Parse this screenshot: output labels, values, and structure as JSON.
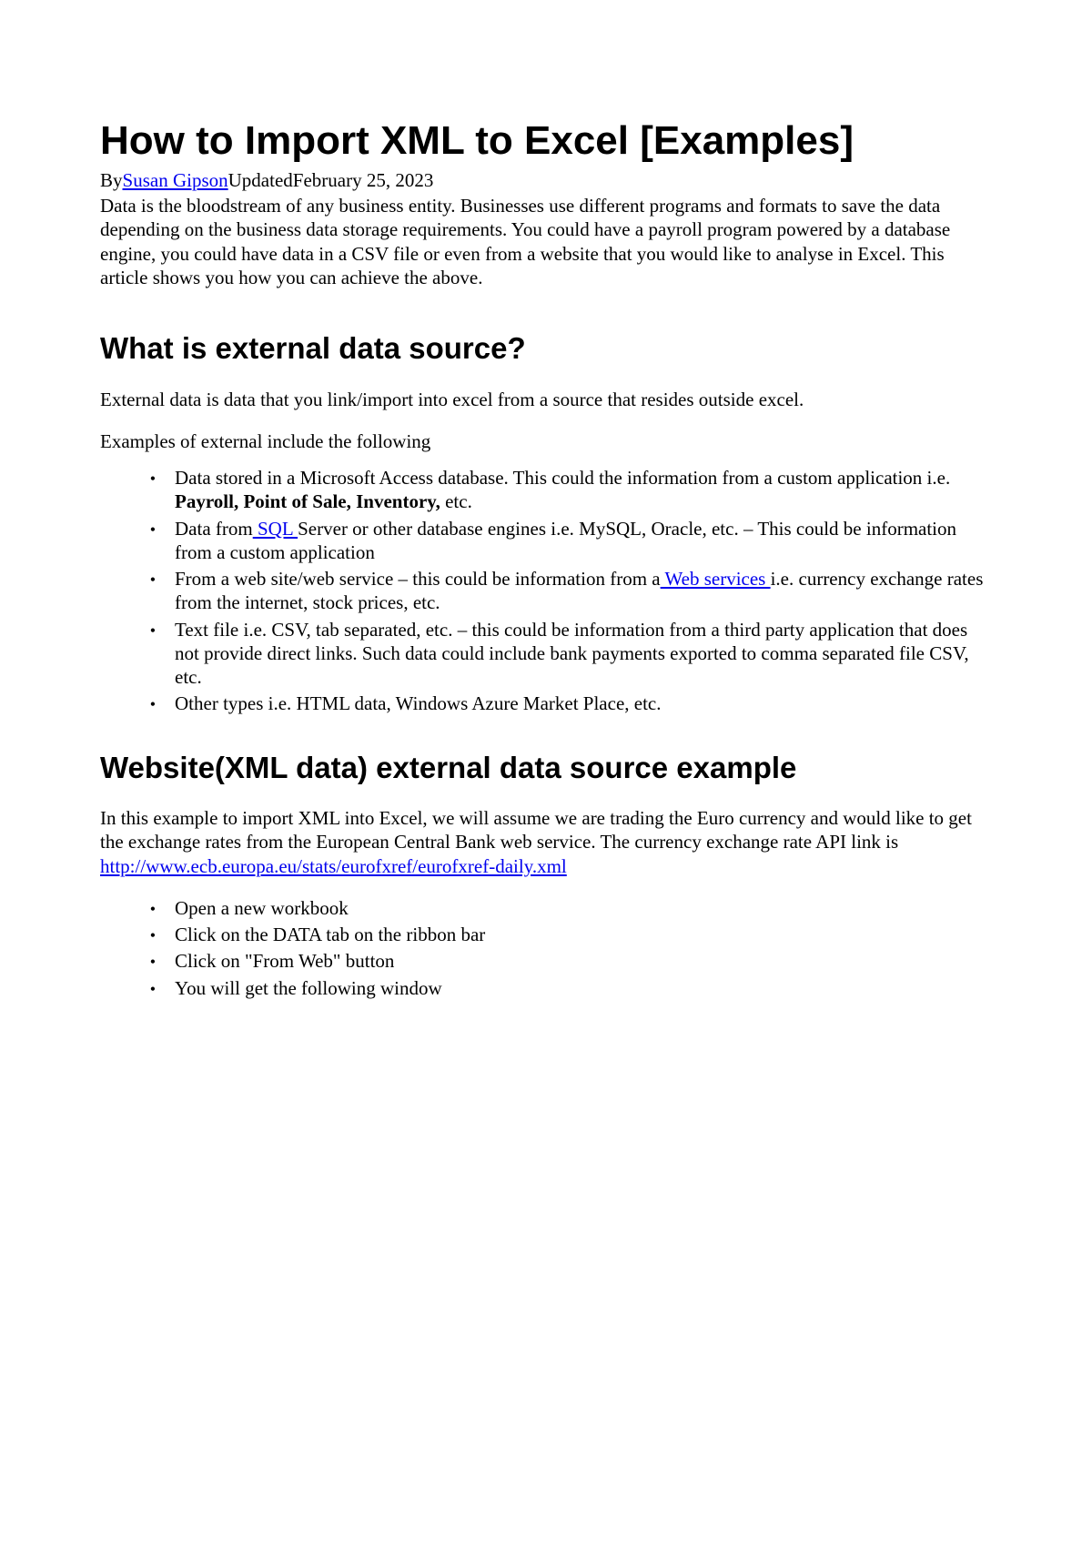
{
  "title": "How to Import XML to Excel [Examples]",
  "byline": {
    "by": "By",
    "author": "Susan Gipson",
    "updated": "Updated",
    "date": "February 25, 2023"
  },
  "intro": "Data is the bloodstream of any business entity. Businesses use different programs and formats to save the data depending on the business data storage requirements. You could have a payroll program powered by a database engine, you could have data in a CSV file or even from a website that you would like to analyse in Excel. This article shows you how you can achieve the above.",
  "section1": {
    "heading": "What is external data source?",
    "p1": "External data is data that you link/import into excel from a source that resides outside excel.",
    "p2": "Examples of external include the following",
    "bullets": {
      "b1a": "Data stored in a Microsoft Access database. This could the information from a custom application i.e. ",
      "b1bold": "Payroll, Point of Sale, Inventory,",
      "b1b": " etc.",
      "b2a": "Data from",
      "b2link": " SQL ",
      "b2b": "Server or other database engines i.e. MySQL, Oracle, etc. – This could be information from a custom application",
      "b3a": "From a web site/web service – this could be information from a",
      "b3link": " Web services ",
      "b3b": "i.e. currency exchange rates from the internet, stock prices, etc.",
      "b4": "Text file i.e. CSV, tab separated, etc. – this could be information from a third party application that does not provide direct links. Such data could include bank payments exported to comma separated file CSV, etc.",
      "b5": "Other types i.e. HTML data, Windows Azure Market Place, etc."
    }
  },
  "section2": {
    "heading": "Website(XML data) external data source example",
    "p1a": "In this example to import XML into Excel, we will assume we are trading the Euro currency and would like to get the exchange rates from the European Central Bank web service. The currency exchange rate API link is ",
    "p1link": "http://www.ecb.europa.eu/stats/eurofxref/eurofxref-daily.xml",
    "bullets": {
      "b1": "Open a new workbook",
      "b2": "Click on the DATA tab on the ribbon bar",
      "b3": "Click on \"From Web\" button",
      "b4": "You will get the following window"
    }
  }
}
